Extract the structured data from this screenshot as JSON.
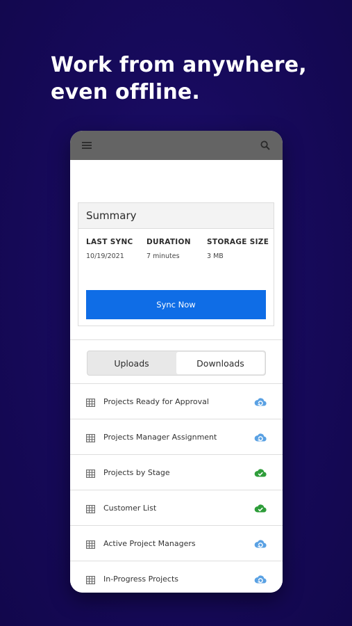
{
  "headline": {
    "line1": "Work from anywhere,",
    "line2": "even offline."
  },
  "appbar": {
    "menu_icon": "menu-icon",
    "search_icon": "search-icon"
  },
  "summary": {
    "title": "Summary",
    "stats": [
      {
        "label": "LAST SYNC",
        "value": "10/19/2021"
      },
      {
        "label": "DURATION",
        "value": "7 minutes"
      },
      {
        "label": "STORAGE SIZE",
        "value": "3 MB"
      }
    ],
    "sync_button": "Sync Now"
  },
  "tabs": {
    "uploads": "Uploads",
    "downloads": "Downloads",
    "selected": "Downloads"
  },
  "downloads": [
    {
      "name": "Projects Ready for Approval",
      "status": "cloud-sync-icon"
    },
    {
      "name": "Projects Manager Assignment",
      "status": "cloud-sync-icon"
    },
    {
      "name": "Projects by Stage",
      "status": "cloud-check-icon"
    },
    {
      "name": "Customer List",
      "status": "cloud-check-icon"
    },
    {
      "name": "Active Project Managers",
      "status": "cloud-sync-icon"
    },
    {
      "name": "In-Progress Projects",
      "status": "cloud-sync-icon"
    }
  ],
  "colors": {
    "background": "#170a5c",
    "appbar": "#646464",
    "primary_button": "#0f6de6",
    "sync_icon": "#5aa1e3",
    "synced_icon": "#2e9d3a"
  }
}
